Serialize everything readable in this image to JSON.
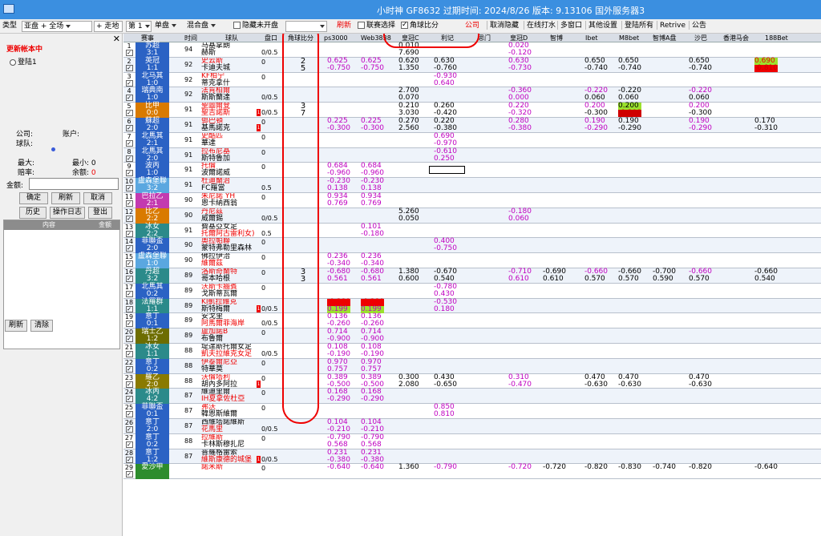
{
  "title_bar": {
    "title": "小时神  GF8632  过期时间: 2024/8/26  版本: 9.13106  国外服务器3"
  },
  "toolbar": {
    "type_label": "类型",
    "type_value": "亚盘 + 全场",
    "area_value": "+ 走地",
    "page_value": "第 1",
    "mode_value": "单盘",
    "mix_value": "混合盘",
    "hide_label": "隐藏未开盘",
    "refresh_label": "刷新",
    "hide_corner_label": "联赛选择",
    "corner_compare_label": "角球比分",
    "public_label": "公司",
    "cancel_hide_label": "取消隐藏",
    "online_label": "在线打水",
    "multi_window_label": "多窗口",
    "other_settings_label": "其他设置",
    "login_all_label": "登陆所有",
    "retrive_label": "Retrive",
    "notice_label": "公告"
  },
  "left_panel": {
    "status": "更新帐本中",
    "login_option": "登陆1",
    "company_label": "公司:",
    "account_label": "账户:",
    "ball_team_label": "球队:",
    "max_label": "最大:",
    "min_label": "最小:",
    "min_value": "0",
    "rate_label": "赔率:",
    "balance_label": "余额:",
    "balance_value": "0",
    "amount_label": "金额:",
    "confirm_btn": "确定",
    "refresh_btn": "刷新",
    "cancel_btn": "取消",
    "history_btn": "历史",
    "oplog_btn": "操作日志",
    "logout_btn": "登出",
    "list_col1": "内容",
    "list_col2": "金额",
    "bottom_refresh_btn": "刷新",
    "clear_btn": "清除"
  },
  "grid_header": {
    "col_league": "赛事",
    "col_time": "时间",
    "col_teams": "球队",
    "col_handicap": "盘口",
    "col_corner": "角球比分",
    "col_ps3000": "ps3000",
    "col_web3838": "Web3838",
    "col_crown": "皇冠C",
    "col_lideji": "利记",
    "col_menmen": "思门",
    "col_crownd": "皇冠D",
    "col_bo": "智博",
    "col_ibet": "Ibet",
    "col_m8": "M8bet",
    "col_bo_a": "智博A盘",
    "col_shaba": "沙巴",
    "col_hk": "香港马会",
    "col_188": "188Bet"
  },
  "rows": [
    {
      "n": "1",
      "league": "苏超",
      "score": "3:1",
      "lc": "blue",
      "time": "94",
      "t1": "马基拿朗",
      "t2": "赫斯",
      "t1c": "#000",
      "t2c": "#000",
      "hc": "0/0.5",
      "corner": "",
      "cols": {
        "cc": [
          "0.010",
          "7.690"
        ],
        "cd": [
          "0.020",
          "-0.120"
        ]
      }
    },
    {
      "n": "2",
      "league": "英冠",
      "score": "1:1",
      "lc": "blue",
      "time": "92",
      "t1": "史云斯",
      "t2": "卡迪夫城",
      "t1c": "#e00",
      "t2c": "#000",
      "hc": "0",
      "corner": "2\n5",
      "cols": {
        "ps": [
          "0.625",
          "-0.750"
        ],
        "web": [
          "0.625",
          "-0.750"
        ],
        "cc": [
          "0.620",
          "1.350"
        ],
        "lj": [
          "0.630",
          "-0.760"
        ],
        "cd": [
          "0.630",
          "-0.730"
        ],
        "ib": [
          "0.650",
          "-0.740"
        ],
        "m8": [
          "0.650",
          "-0.740"
        ],
        "sb": [
          "0.650",
          "-0.740"
        ],
        "b188": [
          "0.690",
          "-0.810"
        ]
      }
    },
    {
      "n": "3",
      "league": "北马其",
      "score": "1:0",
      "lc": "blue",
      "time": "92",
      "t1": "KF柏宁",
      "t2": "蒂克拿什",
      "t1c": "#e00",
      "t2c": "#000",
      "hc": "0",
      "corner": "",
      "cols": {
        "lj": [
          "-0.930",
          "0.640"
        ]
      }
    },
    {
      "n": "4",
      "league": "瑞典南",
      "score": "1:0",
      "lc": "blue",
      "time": "92",
      "t1": "法肯柏爾",
      "t2": "斯斯蘭達",
      "t1c": "#e00",
      "t2c": "#000",
      "hc": "0/0.5",
      "corner": "",
      "cols": {
        "cc": [
          "2.700",
          "0.070"
        ],
        "cd": [
          "-0.360",
          "0.000"
        ],
        "ib": [
          "-0.220",
          "0.060"
        ],
        "m8": [
          "-0.220",
          "0.060"
        ],
        "sb": [
          "-0.220",
          "0.060"
        ]
      }
    },
    {
      "n": "5",
      "league": "比甲",
      "score": "0:0",
      "lc": "orange",
      "time": "91",
      "t1": "聖圖爾登",
      "t2": "聖吉諾斯",
      "t1c": "#e00",
      "t2c": "#e00",
      "hc": "0/0.5",
      "corner": "3\n7",
      "cols": {
        "cc": [
          "0.210",
          "3.030"
        ],
        "lj": [
          "0.260",
          "-0.420"
        ],
        "cd": [
          "0.220",
          "-0.320"
        ],
        "ib": [
          "0.200",
          "-0.300"
        ],
        "m8": [
          "0.200",
          "-0.300"
        ],
        "sb": [
          "0.200",
          "-0.300"
        ]
      }
    },
    {
      "n": "6",
      "league": "蘇超",
      "score": "2:0",
      "lc": "blue",
      "time": "91",
      "t1": "鄧巴頓",
      "t2": "基馬諾克",
      "t1c": "#e00",
      "t2c": "#000",
      "hc": "0",
      "corner": "",
      "cols": {
        "ps": [
          "0.225",
          "-0.300"
        ],
        "web": [
          "0.225",
          "-0.300"
        ],
        "cc": [
          "0.270",
          "2.560"
        ],
        "lj": [
          "0.220",
          "-0.380"
        ],
        "cd": [
          "0.280",
          "-0.380"
        ],
        "ib": [
          "0.190",
          "-0.290"
        ],
        "m8": [
          "0.190",
          "-0.290"
        ],
        "sb": [
          "0.190",
          "-0.290"
        ],
        "b188": [
          "0.170",
          "-0.310"
        ]
      }
    },
    {
      "n": "7",
      "league": "北馬其",
      "score": "2:1",
      "lc": "blue",
      "time": "91",
      "t1": "史酷匹",
      "t2": "華達",
      "t1c": "#e00",
      "t2c": "#000",
      "hc": "0",
      "corner": "",
      "cols": {
        "lj": [
          "0.690",
          "-0.970"
        ]
      }
    },
    {
      "n": "8",
      "league": "北馬其",
      "score": "2:0",
      "lc": "blue",
      "time": "91",
      "t1": "拉布尼基",
      "t2": "斯特魯加",
      "t1c": "#e00",
      "t2c": "#000",
      "hc": "0",
      "corner": "",
      "cols": {
        "lj": [
          "-0.610",
          "0.250"
        ]
      }
    },
    {
      "n": "9",
      "league": "波丙",
      "score": "1:0",
      "lc": "blue",
      "time": "91",
      "t1": "托倫",
      "t2": "波爾諾威",
      "t1c": "#e00",
      "t2c": "#000",
      "hc": "0",
      "corner": "",
      "cols": {
        "ps": [
          "0.684",
          "-0.960"
        ],
        "web": [
          "0.684",
          "-0.960"
        ]
      }
    },
    {
      "n": "10",
      "league": "盧森堡聯",
      "score": "3:2",
      "lc": "lightblue",
      "time": "91",
      "t1": "杜迪蘭治",
      "t2": "FC羅當",
      "t1c": "#e00",
      "t2c": "#000",
      "hc": "0.5",
      "corner": "",
      "cols": {
        "ps": [
          "-0.230",
          "0.138"
        ],
        "web": [
          "-0.230",
          "0.138"
        ]
      }
    },
    {
      "n": "11",
      "league": "巴拉乙",
      "score": "2:1",
      "lc": "magenta",
      "time": "90",
      "t1": "朱尼諾 YH",
      "t2": "恩卡納西翁",
      "t1c": "#e00",
      "t2c": "#000",
      "hc": "0",
      "corner": "",
      "cols": {
        "ps": [
          "0.934",
          "0.769"
        ],
        "web": [
          "0.934",
          "0.769"
        ]
      }
    },
    {
      "n": "12",
      "league": "比乙",
      "score": "2:2",
      "lc": "orange",
      "time": "90",
      "t1": "丹尼茲",
      "t2": "威爾錫",
      "t1c": "#e00",
      "t2c": "#000",
      "hc": "0/0.5",
      "corner": "",
      "cols": {
        "cc": [
          "5.260",
          "0.050"
        ],
        "cd": [
          "-0.180",
          "0.060"
        ]
      }
    },
    {
      "n": "13",
      "league": "冰女",
      "score": "2:2",
      "lc": "teal",
      "time": "91",
      "t1": "費基亞女足",
      "t2": "托爾阿古雷利女)",
      "t1c": "#000",
      "t2c": "#e00",
      "hc": "0.5",
      "corner": "",
      "cols": {
        "web": [
          "0.101",
          "-0.180"
        ]
      }
    },
    {
      "n": "14",
      "league": "菲聯盃",
      "score": "2:0",
      "lc": "blue",
      "time": "90",
      "t1": "奧拉帕聯",
      "t2": "蒙特弗勒里森林",
      "t1c": "#e00",
      "t2c": "#000",
      "hc": "0",
      "corner": "",
      "cols": {
        "lj": [
          "0.400",
          "-0.750"
        ]
      }
    },
    {
      "n": "15",
      "league": "盧森堡聯",
      "score": "1:0",
      "lc": "lightblue",
      "time": "90",
      "t1": "佛拉伊洽",
      "t2": "維爾茲",
      "t1c": "#000",
      "t2c": "#e00",
      "hc": "0",
      "corner": "",
      "cols": {
        "ps": [
          "0.236",
          "-0.340"
        ],
        "web": [
          "0.236",
          "-0.340"
        ]
      }
    },
    {
      "n": "16",
      "league": "丹超",
      "score": "3:2",
      "lc": "teal",
      "time": "89",
      "t1": "洛斯奇蘭特",
      "t2": "哥本哈根",
      "t1c": "#e00",
      "t2c": "#000",
      "hc": "0",
      "corner": "3\n3",
      "cols": {
        "ps": [
          "-0.680",
          "0.561"
        ],
        "web": [
          "-0.680",
          "0.561"
        ],
        "cc": [
          "1.380",
          "0.600"
        ],
        "lj": [
          "-0.670",
          "0.540"
        ],
        "cd": [
          "-0.710",
          "0.610"
        ],
        "bo": [
          "-0.690",
          "0.610"
        ],
        "ib": [
          "-0.660",
          "0.570"
        ],
        "m8": [
          "-0.660",
          "0.570"
        ],
        "boa": [
          "-0.700",
          "0.590"
        ],
        "sb": [
          "-0.660",
          "0.570"
        ],
        "b188": [
          "-0.660",
          "0.540"
        ]
      }
    },
    {
      "n": "17",
      "league": "北馬其",
      "score": "0:2",
      "lc": "blue",
      "time": "89",
      "t1": "沃斯卡牆賓",
      "t2": "戈斯蒂瓦爾",
      "t1c": "#e00",
      "t2c": "#000",
      "hc": "0",
      "corner": "",
      "cols": {
        "lj": [
          "-0.780",
          "0.430"
        ]
      }
    },
    {
      "n": "18",
      "league": "法羅群",
      "score": "1:1",
      "lc": "teal",
      "time": "89",
      "t1": "KI凱拉維克",
      "t2": "斯特梅爾",
      "t1c": "#e00",
      "t2c": "#000",
      "hc": "0/0.5",
      "corner": "",
      "cols": {
        "ps": [
          "-0.280",
          "0.199"
        ],
        "web": [
          "-0.280",
          "0.199"
        ],
        "lj": [
          "-0.530",
          "0.180"
        ]
      }
    },
    {
      "n": "19",
      "league": "意丁",
      "score": "0:1",
      "lc": "blue",
      "time": "89",
      "t1": "安戈里",
      "t2": "阿馬爾菲海岸",
      "t1c": "#000",
      "t2c": "#e00",
      "hc": "0/0.5",
      "corner": "",
      "cols": {
        "ps": [
          "0.136",
          "-0.260"
        ],
        "web": [
          "0.136",
          "-0.260"
        ]
      }
    },
    {
      "n": "20",
      "league": "瑞士乙",
      "score": "1:2",
      "lc": "olive",
      "time": "89",
      "t1": "盧加諾B",
      "t2": "布魯爾",
      "t1c": "#e00",
      "t2c": "#000",
      "hc": "0",
      "corner": "",
      "cols": {
        "ps": [
          "0.714",
          "-0.900"
        ],
        "web": [
          "0.714",
          "-0.900"
        ]
      }
    },
    {
      "n": "21",
      "league": "冰女",
      "score": "1:1",
      "lc": "teal",
      "time": "88",
      "t1": "堤達斯托爾女足",
      "t2": "凱夫拉維克女足",
      "t1c": "#000",
      "t2c": "#e00",
      "hc": "0/0.5",
      "corner": "",
      "cols": {
        "ps": [
          "0.108",
          "-0.190"
        ],
        "web": [
          "0.108",
          "-0.190"
        ]
      }
    },
    {
      "n": "22",
      "league": "意丁",
      "score": "0:2",
      "lc": "blue",
      "time": "88",
      "t1": "伊泰爾尼亞",
      "t2": "特華莫",
      "t1c": "#e00",
      "t2c": "#000",
      "hc": "0",
      "corner": "",
      "cols": {
        "ps": [
          "0.970",
          "0.757"
        ],
        "web": [
          "0.970",
          "0.757"
        ]
      }
    },
    {
      "n": "23",
      "league": "羅乙",
      "score": "2:0",
      "lc": "olive2",
      "time": "88",
      "t1": "沃倫塔利",
      "t2": "胡內多阿拉",
      "t1c": "#e00",
      "t2c": "#000",
      "hc": "0",
      "corner": "",
      "cols": {
        "ps": [
          "0.389",
          "-0.500"
        ],
        "web": [
          "0.389",
          "-0.500"
        ],
        "cc": [
          "0.300",
          "2.080"
        ],
        "lj": [
          "0.430",
          "-0.650"
        ],
        "cd": [
          "0.310",
          "-0.470"
        ],
        "ib": [
          "0.470",
          "-0.630"
        ],
        "m8": [
          "0.470",
          "-0.630"
        ],
        "sb": [
          "0.470",
          "-0.630"
        ]
      }
    },
    {
      "n": "24",
      "league": "冰丙",
      "score": "4:2",
      "lc": "teal",
      "time": "87",
      "t1": "維迪里爾",
      "t2": "IH夏拿佐杜亞",
      "t1c": "#000",
      "t2c": "#e00",
      "hc": "0",
      "corner": "",
      "cols": {
        "ps": [
          "0.168",
          "-0.290"
        ],
        "web": [
          "0.168",
          "-0.290"
        ]
      }
    },
    {
      "n": "25",
      "league": "菲聯盃",
      "score": "0:1",
      "lc": "blue",
      "time": "87",
      "t1": "弗沃",
      "t2": "韓恩斯維爾",
      "t1c": "#e00",
      "t2c": "#000",
      "hc": "0",
      "corner": "",
      "cols": {
        "lj": [
          "0.850",
          "0.810"
        ]
      }
    },
    {
      "n": "26",
      "league": "意丁",
      "score": "2:0",
      "lc": "blue",
      "time": "87",
      "t1": "西維塔諾維斯",
      "t2": "花馬里",
      "t1c": "#000",
      "t2c": "#e00",
      "hc": "0/0.5",
      "corner": "",
      "cols": {
        "ps": [
          "0.104",
          "-0.210"
        ],
        "web": [
          "0.104",
          "-0.210"
        ]
      }
    },
    {
      "n": "27",
      "league": "意丁",
      "score": "0:2",
      "lc": "blue",
      "time": "88",
      "t1": "拉維斯",
      "t2": "卡林斯穆扎尼",
      "t1c": "#e00",
      "t2c": "#000",
      "hc": "0",
      "corner": "",
      "cols": {
        "ps": [
          "-0.790",
          "0.568"
        ],
        "web": [
          "-0.790",
          "0.568"
        ]
      }
    },
    {
      "n": "28",
      "league": "意丁",
      "score": "1:2",
      "lc": "blue",
      "time": "87",
      "t1": "普羅格雷索",
      "t2": "維斯康德的城堡",
      "t1c": "#000",
      "t2c": "#e00",
      "hc": "0/0.5",
      "corner": "",
      "cols": {
        "ps": [
          "0.231",
          "-0.380"
        ],
        "web": [
          "0.231",
          "-0.380"
        ]
      }
    },
    {
      "n": "29",
      "league": "愛沙甲",
      "score": "",
      "lc": "green",
      "time": "",
      "t1": "諾米斯",
      "t2": "",
      "t1c": "#e00",
      "t2c": "#000",
      "hc": "0",
      "corner": "",
      "cols": {
        "ps": [
          "-0.640",
          ""
        ],
        "web": [
          "-0.640",
          ""
        ],
        "cc": [
          "1.360",
          ""
        ],
        "lj": [
          "-0.790",
          ""
        ],
        "cd": [
          "-0.720",
          ""
        ],
        "bo": [
          "-0.720",
          ""
        ],
        "ib": [
          "-0.820",
          ""
        ],
        "m8": [
          "-0.830",
          ""
        ],
        "boa": [
          "-0.740",
          ""
        ],
        "sb": [
          "-0.820",
          ""
        ],
        "b188": [
          "-0.640",
          ""
        ]
      }
    }
  ],
  "colors": {
    "title_bg": "#3b8fe0",
    "header_bg": "#d9dee6",
    "league_blue": "#2b62c4",
    "highlight_red": "#e00000",
    "highlight_lime": "#9be22d",
    "annotation_red": "#e00000"
  }
}
